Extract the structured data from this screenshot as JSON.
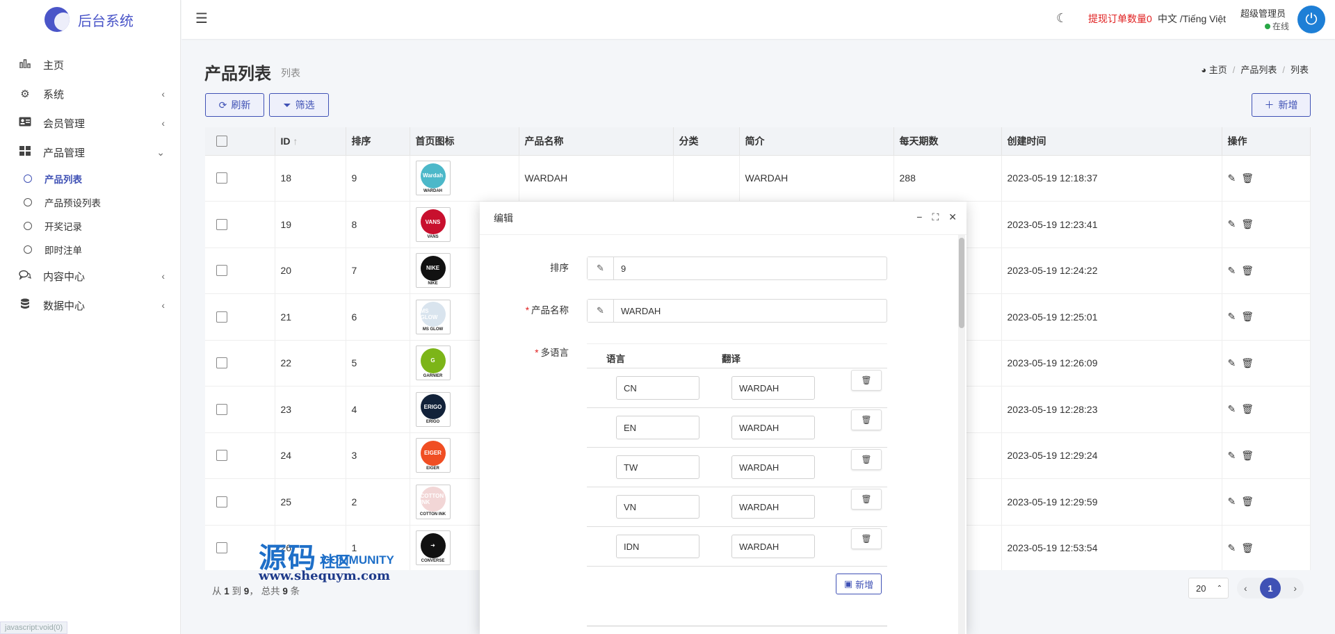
{
  "brand": {
    "title": "后台系统"
  },
  "sidebar": {
    "items": [
      {
        "label": "主页",
        "icon": "bar-chart-icon"
      },
      {
        "label": "系统",
        "icon": "gear-icon"
      },
      {
        "label": "会员管理",
        "icon": "id-card-icon"
      },
      {
        "label": "产品管理",
        "icon": "grid-icon"
      },
      {
        "label": "内容中心",
        "icon": "chat-icon"
      },
      {
        "label": "数据中心",
        "icon": "database-icon"
      }
    ],
    "sub_items": [
      {
        "label": "产品列表",
        "active": true
      },
      {
        "label": "产品预设列表",
        "active": false
      },
      {
        "label": "开奖记录",
        "active": false
      },
      {
        "label": "即时注单",
        "active": false
      }
    ],
    "status_tip": "javascript:void(0)"
  },
  "topbar": {
    "withdraw_label": "提现订单数量",
    "withdraw_count": "0",
    "language": "中文 /Tiếng Việt",
    "user_name": "超级管理员",
    "user_status": "在线"
  },
  "page": {
    "title": "产品列表",
    "subtitle": "列表",
    "breadcrumb": [
      "主页",
      "产品列表",
      "列表"
    ]
  },
  "toolbar": {
    "refresh": "刷新",
    "filter": "筛选",
    "add": "新增"
  },
  "table": {
    "columns": [
      "ID",
      "排序",
      "首页图标",
      "产品名称",
      "分类",
      "简介",
      "每天期数",
      "创建时间",
      "操作"
    ],
    "rows": [
      {
        "id": "18",
        "sort": "9",
        "logo": "Wardah",
        "logo_caption": "WARDAH",
        "logo_bg": "#4cb8c9",
        "name": "WARDAH",
        "category": "",
        "intro": "WARDAH",
        "periods": "288",
        "created": "2023-05-19 12:18:37"
      },
      {
        "id": "19",
        "sort": "8",
        "logo": "VANS",
        "logo_caption": "VANS",
        "logo_bg": "#c8102e",
        "name": "",
        "category": "",
        "intro": "",
        "periods": "",
        "created": "2023-05-19 12:23:41"
      },
      {
        "id": "20",
        "sort": "7",
        "logo": "NIKE",
        "logo_caption": "NIKE",
        "logo_bg": "#111111",
        "name": "",
        "category": "",
        "intro": "",
        "periods": "",
        "created": "2023-05-19 12:24:22"
      },
      {
        "id": "21",
        "sort": "6",
        "logo": "MS GLOW",
        "logo_caption": "MS GLOW",
        "logo_bg": "#d9e4ee",
        "name": "",
        "category": "",
        "intro": "",
        "periods": "",
        "created": "2023-05-19 12:25:01"
      },
      {
        "id": "22",
        "sort": "5",
        "logo": "G",
        "logo_caption": "GARNIER",
        "logo_bg": "#7cb518",
        "name": "",
        "category": "",
        "intro": "",
        "periods": "",
        "created": "2023-05-19 12:26:09"
      },
      {
        "id": "23",
        "sort": "4",
        "logo": "ERIGO",
        "logo_caption": "ERIGO",
        "logo_bg": "#12223a",
        "name": "",
        "category": "",
        "intro": "",
        "periods": "",
        "created": "2023-05-19 12:28:23"
      },
      {
        "id": "24",
        "sort": "3",
        "logo": "EIGER",
        "logo_caption": "EIGER",
        "logo_bg": "#f04e23",
        "name": "",
        "category": "",
        "intro": "",
        "periods": "",
        "created": "2023-05-19 12:29:24"
      },
      {
        "id": "25",
        "sort": "2",
        "logo": "COTTON INK",
        "logo_caption": "COTTON INK",
        "logo_bg": "#f2d6d6",
        "name": "",
        "category": "",
        "intro": "",
        "periods": "",
        "created": "2023-05-19 12:29:59"
      },
      {
        "id": "26",
        "sort": "1",
        "logo": "➜",
        "logo_caption": "CONVERSE",
        "logo_bg": "#111111",
        "name": "",
        "category": "",
        "intro": "",
        "periods": "",
        "created": "2023-05-19 12:53:54"
      }
    ]
  },
  "footer": {
    "from": "1",
    "to": "9",
    "total": "9",
    "page_size": "20",
    "current_page": "1"
  },
  "watermark": {
    "title": "源码",
    "mid": "社区",
    "community": "COMMUNITY",
    "url": "www.shequym.com"
  },
  "modal": {
    "title": "编辑",
    "sort_label": "排序",
    "sort_value": "9",
    "name_label": "产品名称",
    "name_value": "WARDAH",
    "multilang_label": "多语言",
    "lang_col": "语言",
    "trans_col": "翻译",
    "langs": [
      {
        "code": "CN",
        "value": "WARDAH"
      },
      {
        "code": "EN",
        "value": "WARDAH"
      },
      {
        "code": "TW",
        "value": "WARDAH"
      },
      {
        "code": "VN",
        "value": "WARDAH"
      },
      {
        "code": "IDN",
        "value": "WARDAH"
      }
    ],
    "add_label": "新增"
  },
  "colors": {
    "primary": "#3f51b5",
    "danger": "#e02020",
    "online": "#28a745"
  }
}
